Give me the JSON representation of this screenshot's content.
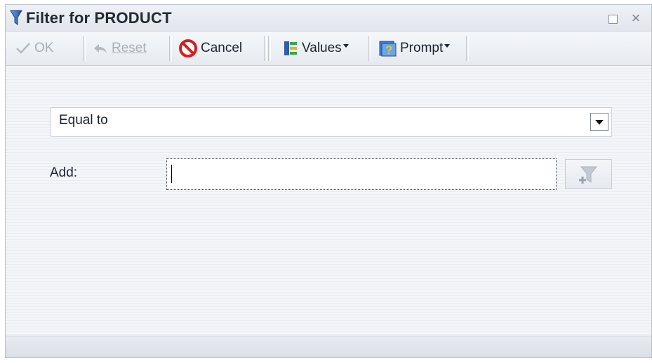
{
  "window": {
    "title": "Filter for PRODUCT",
    "title_icon": "funnel-icon",
    "maximize_icon": "maximize-icon",
    "close_glyph": "×"
  },
  "toolbar": {
    "ok_label": "OK",
    "reset_label": "Reset",
    "cancel_label": "Cancel",
    "values_label": "Values",
    "prompt_label": "Prompt",
    "icons": {
      "ok": "checkmark-icon",
      "reset": "undo-arrow-icon",
      "cancel": "no-entry-icon",
      "values": "values-list-icon",
      "prompt": "question-prompt-icon"
    }
  },
  "form": {
    "operator_value": "Equal to",
    "add_label": "Add:",
    "add_input_value": "",
    "add_button_icon": "add-filter-icon"
  },
  "colors": {
    "cancel_red": "#d21f1f",
    "funnel_blue": "#2b62b8",
    "disabled_text": "#a9b0b8"
  }
}
